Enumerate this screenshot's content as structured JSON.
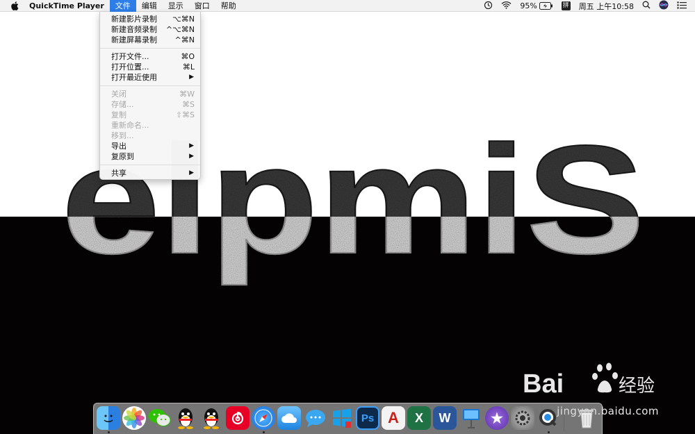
{
  "menubar": {
    "app_name": "QuickTime Player",
    "menus": [
      "文件",
      "编辑",
      "显示",
      "窗口",
      "帮助"
    ],
    "active_menu_index": 0,
    "battery": "95%",
    "clock": "周五 上午10:58",
    "input_method": "拼"
  },
  "file_menu": {
    "items": [
      {
        "label": "新建影片录制",
        "shortcut": "⌥⌘N",
        "enabled": true
      },
      {
        "label": "新建音频录制",
        "shortcut": "^⌥⌘N",
        "enabled": true
      },
      {
        "label": "新建屏幕录制",
        "shortcut": "^⌘N",
        "enabled": true
      },
      {
        "label": "打开文件...",
        "shortcut": "⌘O",
        "enabled": true
      },
      {
        "label": "打开位置...",
        "shortcut": "⌘L",
        "enabled": true
      },
      {
        "label": "打开最近使用",
        "submenu": true,
        "enabled": true
      },
      {
        "label": "关闭",
        "shortcut": "⌘W",
        "enabled": false
      },
      {
        "label": "存储...",
        "shortcut": "⌘S",
        "enabled": false
      },
      {
        "label": "复制",
        "shortcut": "⇧⌘S",
        "enabled": false
      },
      {
        "label": "重新命名...",
        "enabled": false
      },
      {
        "label": "移到...",
        "enabled": false
      },
      {
        "label": "导出",
        "submenu": true,
        "enabled": true
      },
      {
        "label": "复原到",
        "submenu": true,
        "enabled": true
      },
      {
        "label": "共享",
        "submenu": true,
        "enabled": true
      }
    ],
    "submenu_arrow": "▶"
  },
  "artwork": {
    "text": "elpmiS"
  },
  "dock": {
    "apps": [
      {
        "name": "finder-icon",
        "color": "#3d8fe8",
        "glyph": ""
      },
      {
        "name": "photos-icon",
        "color": "#ffffff",
        "glyph": ""
      },
      {
        "name": "wechat-icon",
        "color": "#2dc100",
        "glyph": ""
      },
      {
        "name": "qq-icon",
        "color": "#d8d8d8",
        "glyph": ""
      },
      {
        "name": "qq-icon-2",
        "color": "#d8d8d8",
        "glyph": ""
      },
      {
        "name": "netease-music-icon",
        "color": "#e60026",
        "glyph": ""
      },
      {
        "name": "safari-icon",
        "color": "#1e8ef0",
        "glyph": ""
      },
      {
        "name": "baidu-cloud-icon",
        "color": "#2c8fe6",
        "glyph": ""
      },
      {
        "name": "messages-icon",
        "color": "#3aa8f0",
        "glyph": ""
      },
      {
        "name": "windows-app-icon",
        "color": "#18a0e8",
        "glyph": ""
      },
      {
        "name": "photoshop-icon",
        "color": "#0d2a4a",
        "glyph": "Ps"
      },
      {
        "name": "autocad-icon",
        "color": "#c7231b",
        "glyph": "A"
      },
      {
        "name": "excel-icon",
        "color": "#1f7244",
        "glyph": "X"
      },
      {
        "name": "word-icon",
        "color": "#2b579a",
        "glyph": "W"
      },
      {
        "name": "keynote-icon",
        "color": "#1a75d0",
        "glyph": ""
      },
      {
        "name": "imovie-icon",
        "color": "#6a3fb8",
        "glyph": "★"
      },
      {
        "name": "system-preferences-icon",
        "color": "#8a8a8a",
        "glyph": ""
      },
      {
        "name": "quicktime-icon",
        "color": "#2a2a2a",
        "glyph": ""
      },
      {
        "name": "trash-icon",
        "color": "#e8e8e8",
        "glyph": ""
      }
    ],
    "running": [
      0,
      6,
      17
    ]
  },
  "watermark": {
    "brand": "Bai",
    "brand_cn": "经验",
    "url": "jingyan.baidu.com"
  }
}
